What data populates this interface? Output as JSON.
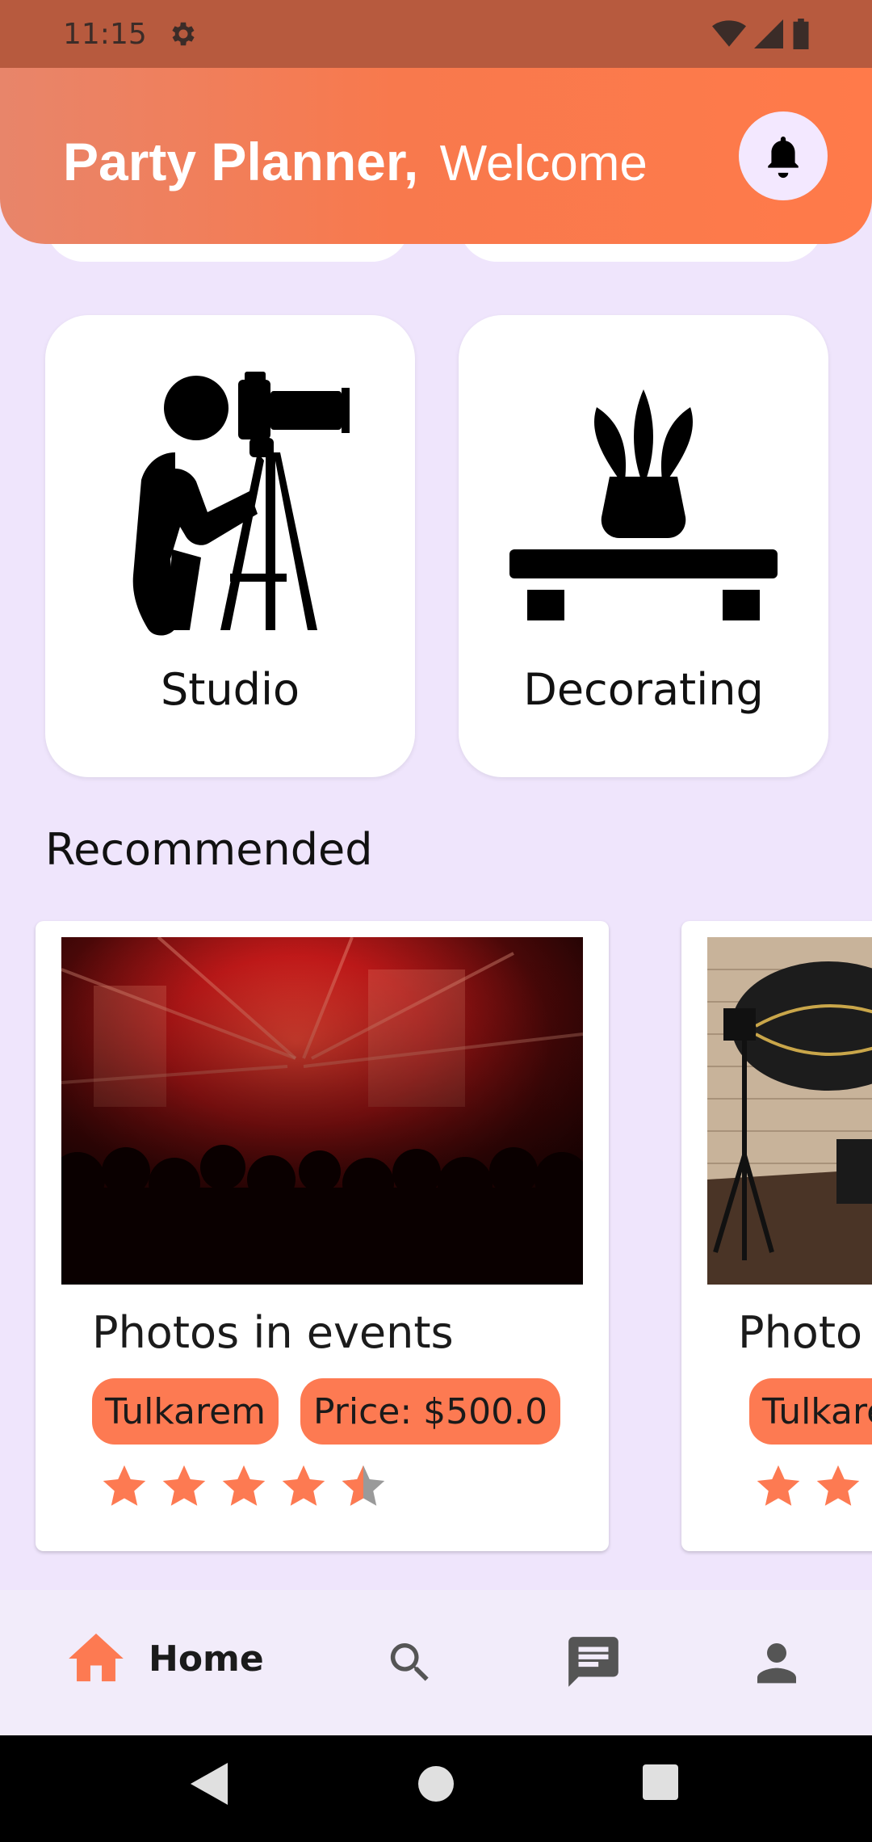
{
  "status_bar": {
    "time": "11:15"
  },
  "header": {
    "title_strong": "Party Planner,",
    "title_welcome": "Welcome"
  },
  "categories": [
    {
      "label": "Studio",
      "icon": "photographer-camera-icon"
    },
    {
      "label": "Decorating",
      "icon": "plant-shelf-icon"
    }
  ],
  "recommended": {
    "section_title": "Recommended",
    "cards": [
      {
        "title": "Photos in events",
        "city": "Tulkarem",
        "price": "Price: $500.0",
        "rating": 4.5
      },
      {
        "title": "Photo",
        "city": "Tulkare",
        "price": "",
        "rating": 2
      }
    ]
  },
  "bottom_nav": {
    "items": [
      {
        "label": "Home",
        "icon": "home-icon",
        "active": true
      },
      {
        "label": "",
        "icon": "search-icon",
        "active": false
      },
      {
        "label": "",
        "icon": "chat-icon",
        "active": false
      },
      {
        "label": "",
        "icon": "person-icon",
        "active": false
      }
    ]
  },
  "colors": {
    "accent": "#fd7a52",
    "background": "#efe5fc",
    "star_inactive": "#9a9a9a"
  }
}
